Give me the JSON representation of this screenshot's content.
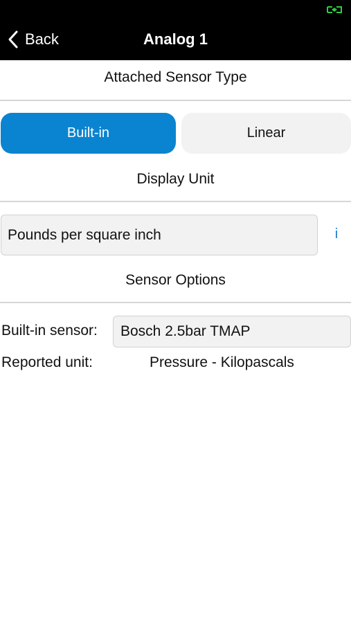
{
  "nav": {
    "back_label": "Back",
    "title": "Analog 1"
  },
  "status": {
    "icon": "battery-charging-icon",
    "color": "#2ecc40"
  },
  "attached_sensor": {
    "header": "Attached Sensor Type",
    "options": [
      "Built-in",
      "Linear"
    ],
    "selected": "Built-in"
  },
  "display_unit": {
    "header": "Display Unit",
    "value": "Pounds per square inch",
    "info_label": "i"
  },
  "sensor_options": {
    "header": "Sensor Options",
    "builtin_label": "Built-in sensor:",
    "builtin_value": "Bosch 2.5bar TMAP",
    "reported_label": "Reported unit:",
    "reported_value": "Pressure - Kilopascals"
  },
  "colors": {
    "accent": "#0a84d0",
    "nav_bg": "#000000",
    "field_bg": "#f2f2f2"
  }
}
